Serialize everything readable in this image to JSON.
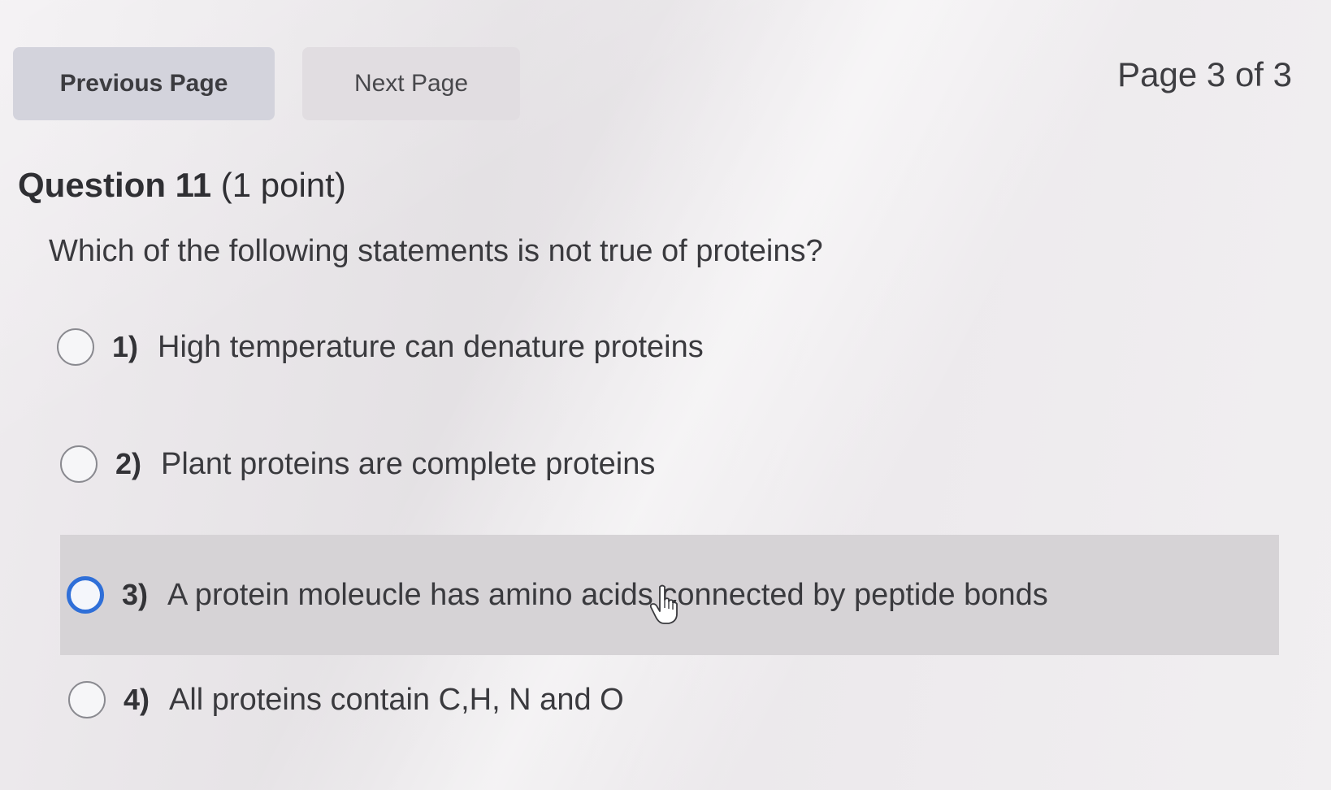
{
  "nav": {
    "previous_label": "Previous Page",
    "next_label": "Next Page",
    "page_indicator": "Page 3 of 3"
  },
  "question": {
    "title": "Question 11",
    "points": "(1 point)",
    "text": "Which of the following statements is not true of proteins?"
  },
  "options": [
    {
      "number": "1)",
      "text": "High temperature can denature proteins",
      "selected": false
    },
    {
      "number": "2)",
      "text": "Plant proteins are complete proteins",
      "selected": false
    },
    {
      "number": "3)",
      "text": "A protein moleucle has amino acids connected by peptide bonds",
      "selected": false,
      "hovered": true
    },
    {
      "number": "4)",
      "text": "All proteins contain C,H, N and O",
      "selected": false
    }
  ],
  "icons": {
    "cursor": "hand-pointer-icon",
    "radio": "radio-button-icon"
  },
  "colors": {
    "focus_ring": "#2f6fd8",
    "hover_bg": "#d6d3d6",
    "prev_button_bg": "#d3d3dc"
  }
}
